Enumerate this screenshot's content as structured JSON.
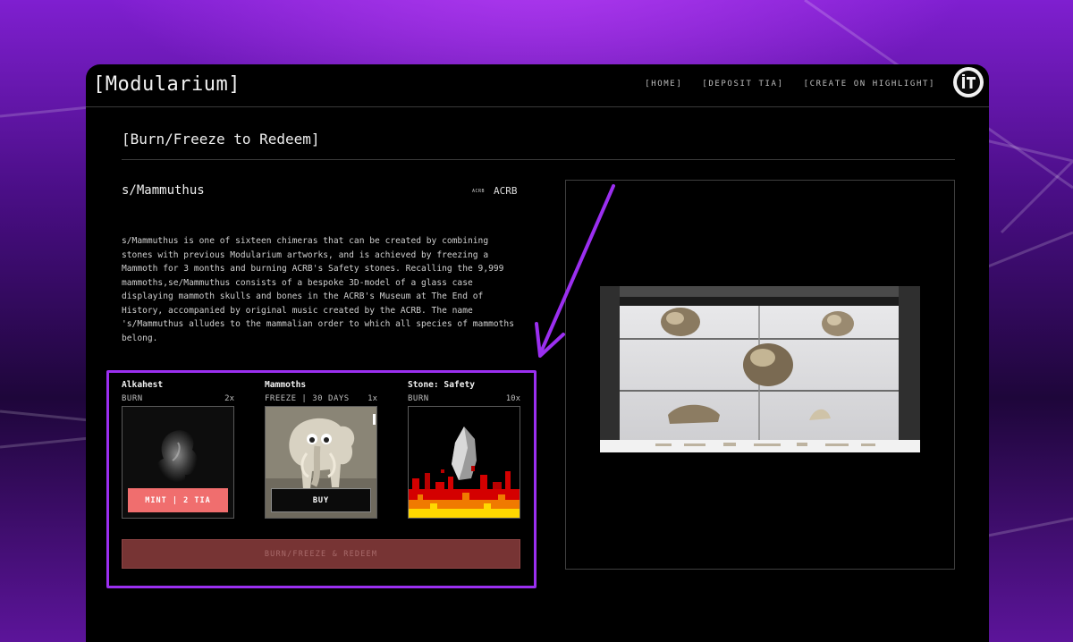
{
  "app": {
    "logo": "[Modularium]",
    "nav": [
      {
        "label": "[HOME]"
      },
      {
        "label": "[DEPOSIT TIA]"
      },
      {
        "label": "[CREATE ON HIGHLIGHT]"
      }
    ],
    "avatar_text": "iTi"
  },
  "page": {
    "title": "[Burn/Freeze to Redeem]",
    "item_name": "s/Mammuthus",
    "creator_mark": "ACRB",
    "creator_name": "ACRB",
    "description": "s/Mammuthus is one of sixteen chimeras that can be created by combining stones with previous Modularium artworks, and is achieved by freezing a Mammoth for 3 months and burning ACRB's Safety stones. Recalling the 9,999 mammoths,se/Mammuthus consists of a bespoke 3D-model of a glass case displaying mammoth skulls and bones in the ACRB's Museum at The End of History, accompanied by original music created by the ACRB. The name 's/Mammuthus alludes to the mammalian order to which all species of mammoths belong."
  },
  "requirements": [
    {
      "name": "Alkahest",
      "action": "BURN",
      "qty": "2x",
      "button": "MINT | 2 TIA",
      "icon": "alkahest-sculpture-image"
    },
    {
      "name": "Mammoths",
      "action": "FREEZE | 30 DAYS",
      "qty": "1x",
      "button": "BUY",
      "icon": "mammoth-artwork-image"
    },
    {
      "name": "Stone: Safety",
      "action": "BURN",
      "qty": "10x",
      "icon": "stone-fire-image"
    }
  ],
  "redeem_button": "BURN/FREEZE & REDEEM",
  "colors": {
    "accent": "#9b2ff0",
    "mint_button": "#f06e6e",
    "redeem_button": "#773434"
  }
}
